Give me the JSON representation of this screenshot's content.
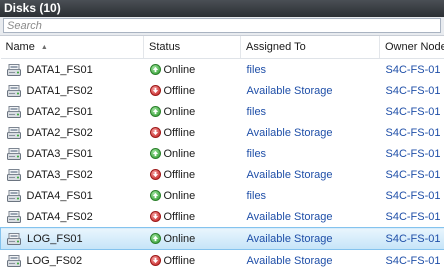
{
  "panel": {
    "title": "Disks (10)"
  },
  "search": {
    "placeholder": "Search"
  },
  "columns": {
    "name": "Name",
    "status": "Status",
    "assigned_to": "Assigned To",
    "owner_node": "Owner Node"
  },
  "rows": [
    {
      "name": "DATA1_FS01",
      "status": "Online",
      "assigned_to": "files",
      "owner_node": "S4C-FS-01"
    },
    {
      "name": "DATA1_FS02",
      "status": "Offline",
      "assigned_to": "Available Storage",
      "owner_node": "S4C-FS-01"
    },
    {
      "name": "DATA2_FS01",
      "status": "Online",
      "assigned_to": "files",
      "owner_node": "S4C-FS-01"
    },
    {
      "name": "DATA2_FS02",
      "status": "Offline",
      "assigned_to": "Available Storage",
      "owner_node": "S4C-FS-01"
    },
    {
      "name": "DATA3_FS01",
      "status": "Online",
      "assigned_to": "files",
      "owner_node": "S4C-FS-01"
    },
    {
      "name": "DATA3_FS02",
      "status": "Offline",
      "assigned_to": "Available Storage",
      "owner_node": "S4C-FS-01"
    },
    {
      "name": "DATA4_FS01",
      "status": "Online",
      "assigned_to": "files",
      "owner_node": "S4C-FS-01"
    },
    {
      "name": "DATA4_FS02",
      "status": "Offline",
      "assigned_to": "Available Storage",
      "owner_node": "S4C-FS-01"
    },
    {
      "name": "LOG_FS01",
      "status": "Online",
      "assigned_to": "Available Storage",
      "owner_node": "S4C-FS-01",
      "selected": true
    },
    {
      "name": "LOG_FS02",
      "status": "Offline",
      "assigned_to": "Available Storage",
      "owner_node": "S4C-FS-01"
    }
  ],
  "icons": {
    "sort": "sort-ascending-icon",
    "disk": "disk-icon",
    "online": "online-arrow-up-icon",
    "offline": "offline-arrow-down-icon"
  },
  "colors": {
    "link_blue": "#1f4fa8",
    "title_bar": "#2f3338",
    "selection": "#cde8fa",
    "online_green": "#2f9c2f",
    "offline_red": "#c21d1d"
  }
}
